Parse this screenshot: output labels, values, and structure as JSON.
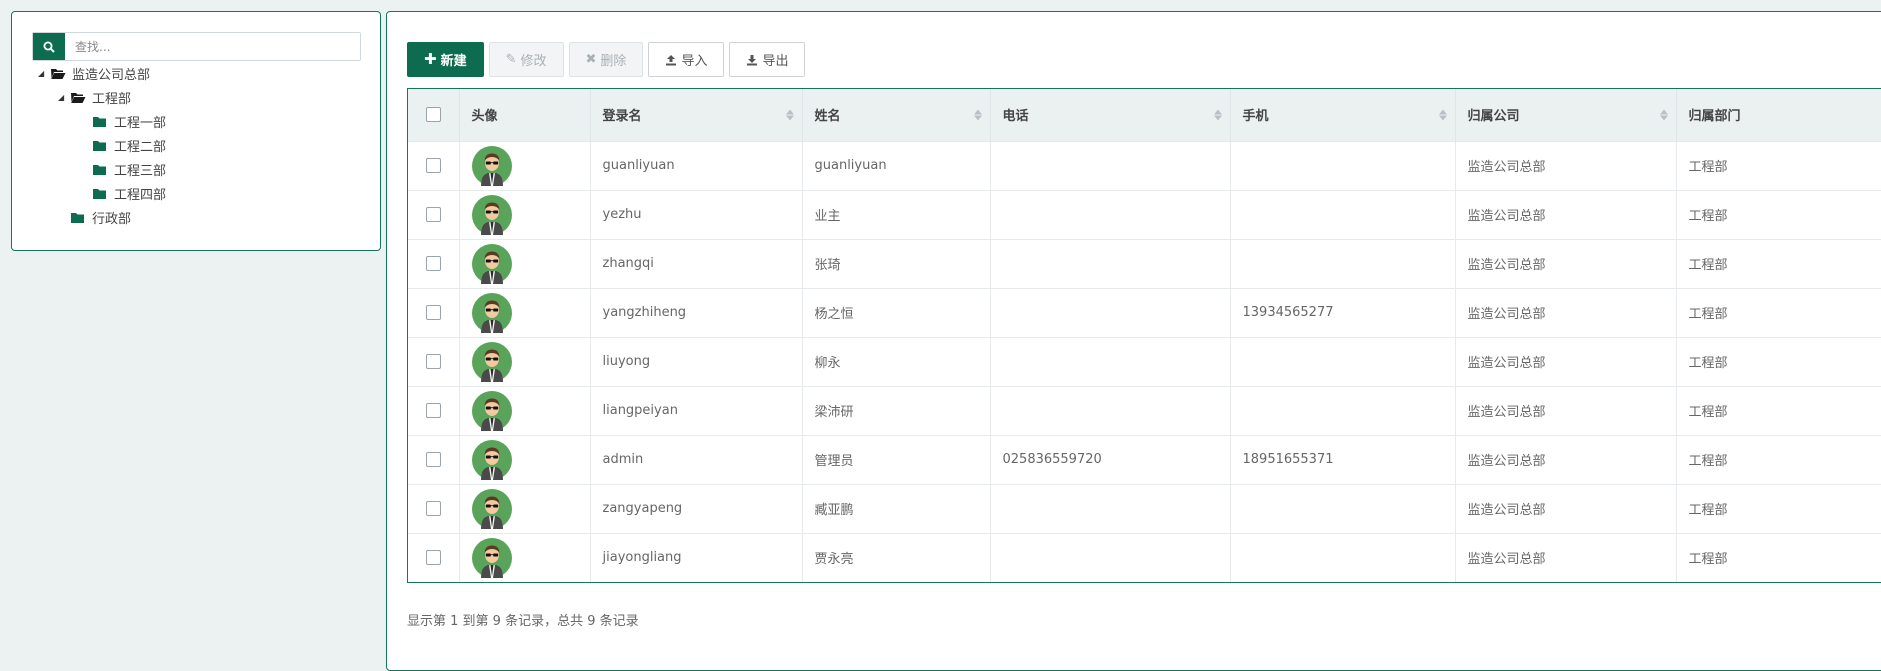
{
  "search": {
    "placeholder": "查找..."
  },
  "tree": [
    {
      "label": "监造公司总部",
      "level": 0,
      "expanded": true,
      "open": true
    },
    {
      "label": "工程部",
      "level": 1,
      "expanded": true,
      "open": true
    },
    {
      "label": "工程一部",
      "level": 2,
      "expanded": false,
      "open": false
    },
    {
      "label": "工程二部",
      "level": 2,
      "expanded": false,
      "open": false
    },
    {
      "label": "工程三部",
      "level": 2,
      "expanded": false,
      "open": false
    },
    {
      "label": "工程四部",
      "level": 2,
      "expanded": false,
      "open": false
    },
    {
      "label": "行政部",
      "level": 1,
      "expanded": false,
      "open": false
    }
  ],
  "toolbar": {
    "new_label": "新建",
    "edit_label": "修改",
    "delete_label": "删除",
    "import_label": "导入",
    "export_label": "导出"
  },
  "table": {
    "columns": [
      "头像",
      "登录名",
      "姓名",
      "电话",
      "手机",
      "归属公司",
      "归属部门"
    ],
    "rows": [
      {
        "login": "guanliyuan",
        "name": "guanliyuan",
        "phone": "",
        "mobile": "",
        "company": "监造公司总部",
        "dept": "工程部"
      },
      {
        "login": "yezhu",
        "name": "业主",
        "phone": "",
        "mobile": "",
        "company": "监造公司总部",
        "dept": "工程部"
      },
      {
        "login": "zhangqi",
        "name": "张琦",
        "phone": "",
        "mobile": "",
        "company": "监造公司总部",
        "dept": "工程部"
      },
      {
        "login": "yangzhiheng",
        "name": "杨之恒",
        "phone": "",
        "mobile": "13934565277",
        "company": "监造公司总部",
        "dept": "工程部"
      },
      {
        "login": "liuyong",
        "name": "柳永",
        "phone": "",
        "mobile": "",
        "company": "监造公司总部",
        "dept": "工程部"
      },
      {
        "login": "liangpeiyan",
        "name": "梁沛研",
        "phone": "",
        "mobile": "",
        "company": "监造公司总部",
        "dept": "工程部"
      },
      {
        "login": "admin",
        "name": "管理员",
        "phone": "025836559720",
        "mobile": "18951655371",
        "company": "监造公司总部",
        "dept": "工程部"
      },
      {
        "login": "zangyapeng",
        "name": "臧亚鹏",
        "phone": "",
        "mobile": "",
        "company": "监造公司总部",
        "dept": "工程部"
      },
      {
        "login": "jiayongliang",
        "name": "贾永亮",
        "phone": "",
        "mobile": "",
        "company": "监造公司总部",
        "dept": "工程部"
      }
    ]
  },
  "footer": {
    "text": "显示第 1 到第 9 条记录，总共 9 条记录"
  },
  "colors": {
    "accent": "#0d6c50",
    "border": "#17755a",
    "background": "#ecf1f1"
  }
}
